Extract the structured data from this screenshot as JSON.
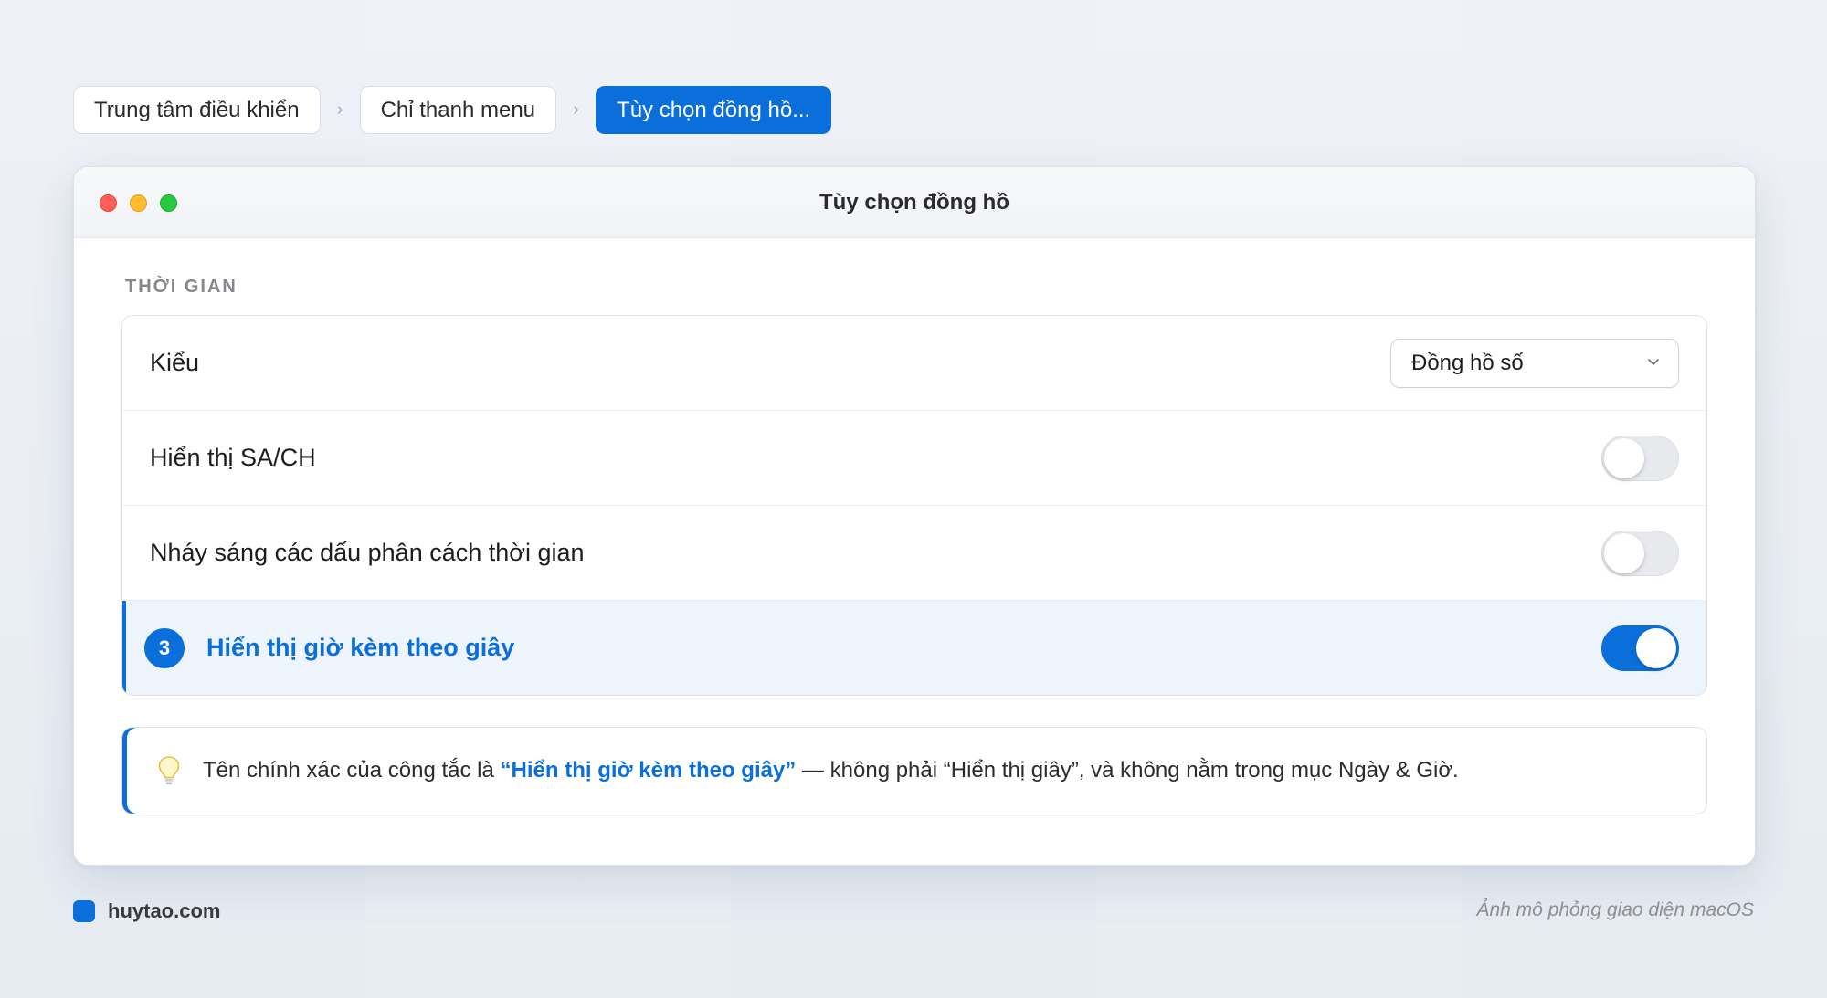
{
  "breadcrumb": {
    "items": [
      {
        "label": "Trung tâm điều khiển"
      },
      {
        "label": "Chỉ thanh menu"
      },
      {
        "label": "Tùy chọn đồng hồ..."
      }
    ],
    "separator": "›"
  },
  "window": {
    "title": "Tùy chọn đồng hồ",
    "section_label": "THỜI GIAN",
    "rows": [
      {
        "label": "Kiểu",
        "control": "select",
        "value": "Đồng hồ số"
      },
      {
        "label": "Hiển thị SA/CH",
        "control": "toggle",
        "on": false
      },
      {
        "label": "Nháy sáng các dấu phân cách thời gian",
        "control": "toggle",
        "on": false
      },
      {
        "label": "Hiển thị giờ kèm theo giây",
        "control": "toggle",
        "on": true,
        "step": "3"
      }
    ],
    "tip": {
      "prefix": "Tên chính xác của công tắc là ",
      "highlight": "“Hiển thị giờ kèm theo giây”",
      "suffix": " — không phải “Hiển thị giây”, và không nằm trong mục Ngày & Giờ."
    }
  },
  "footer": {
    "brand": "huytao.com",
    "note": "Ảnh mô phỏng giao diện macOS"
  },
  "colors": {
    "accent": "#0a6fdb",
    "traffic_red": "#ff5f57",
    "traffic_yellow": "#febc2e",
    "traffic_green": "#28c840"
  },
  "icons": {
    "tip": "lightbulb-icon",
    "select": "chevron-down-icon"
  }
}
